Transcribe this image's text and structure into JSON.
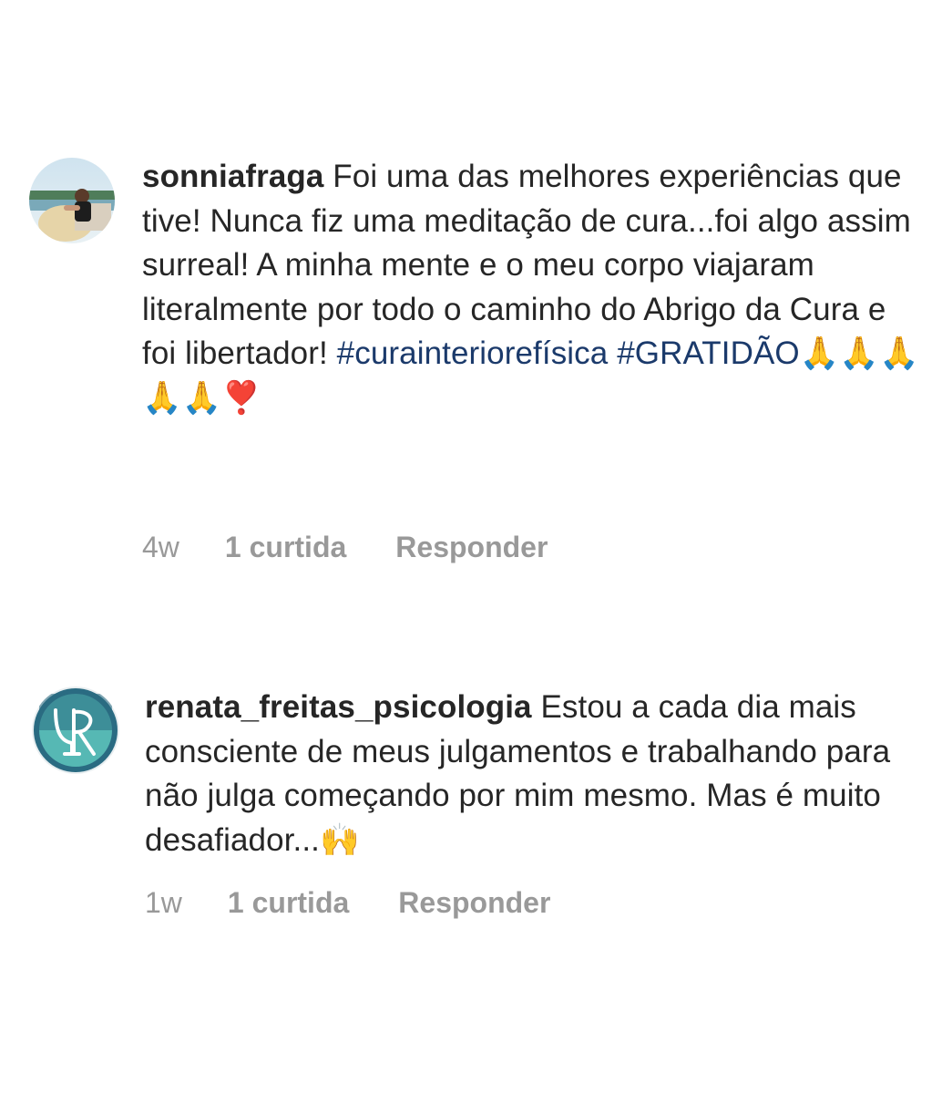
{
  "comments": [
    {
      "username": "sonniafraga",
      "text": " Foi uma das melhores experiências que tive! Nunca fiz uma meditação de cura...foi algo assim surreal! A minha mente e o meu corpo  viajaram literalmente por todo o caminho do Abrigo da Cura e foi libertador! ",
      "hashtags": [
        "#curainteriorefísica",
        "#GRATIDÃO"
      ],
      "emojis_line": "🙏🙏🙏",
      "emojis_line2": "🙏🙏❣️",
      "time": "4w",
      "likes": "1 curtida",
      "reply": "Responder"
    },
    {
      "username": "renata_freitas_psicologia",
      "text": " Estou a cada dia mais consciente de meus julgamentos e trabalhando para não julga começando por mim mesmo. Mas é muito desafiador...",
      "emoji": "🙌",
      "time": "1w",
      "likes": "1 curtida",
      "reply": "Responder"
    }
  ],
  "colors": {
    "text": "#262626",
    "hashtag": "#1b3a6b",
    "meta": "#999999",
    "avatar2_ring": "#2a6b82",
    "avatar2_fill": "#56b8b4"
  }
}
